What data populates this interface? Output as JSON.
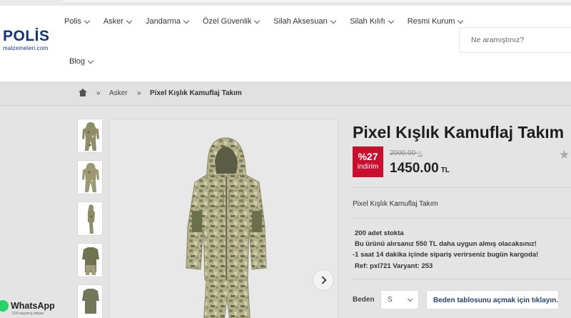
{
  "logo": {
    "word": "POLİS",
    "sub": "malzemeleri.com"
  },
  "nav": {
    "items": [
      {
        "label": "Polis"
      },
      {
        "label": "Asker"
      },
      {
        "label": "Jandarma"
      },
      {
        "label": "Özel Güvenlik"
      },
      {
        "label": "Silah Aksesuarı"
      },
      {
        "label": "Silah Kılıfı"
      },
      {
        "label": "Resmi Kurum"
      }
    ],
    "second_row": {
      "label": "Blog"
    }
  },
  "search": {
    "placeholder": "Ne aramıştınız?"
  },
  "breadcrumb": {
    "separator": "»",
    "items": [
      "Asker",
      "Pixel Kışlık Kamuflaj Takım"
    ]
  },
  "product": {
    "title": "Pixel Kışlık Kamuflaj Takım",
    "discount": {
      "percent": "%27",
      "label": "indirim"
    },
    "old_price": "2000.00",
    "new_price": "1450.00",
    "currency": "TL",
    "short_description": "Pixel Kışlık Kamuflaj Takım",
    "stock_text": "200 adet stokta",
    "savings_text": "Bu ürünü alırsanız 550 TL daha uygun almış olacaksınız!",
    "shipping_text": "-1 saat 14 dakika içinde sipariş verirseniz bugün kargoda!",
    "ref_text": "Ref: pxl721 Varyant: 253",
    "variant_label": "Beden",
    "variant_value": "S",
    "size_table_button": "Beden tablosunu açmak için tıklayın."
  },
  "whatsapp": {
    "label": "WhatsApp",
    "sub": "7/24 alışveriş imkanı"
  },
  "colors": {
    "accent_red": "#c8102e",
    "logo_blue": "#13347a",
    "camo_light": "#b8b48e",
    "camo_dark": "#6f7350"
  }
}
